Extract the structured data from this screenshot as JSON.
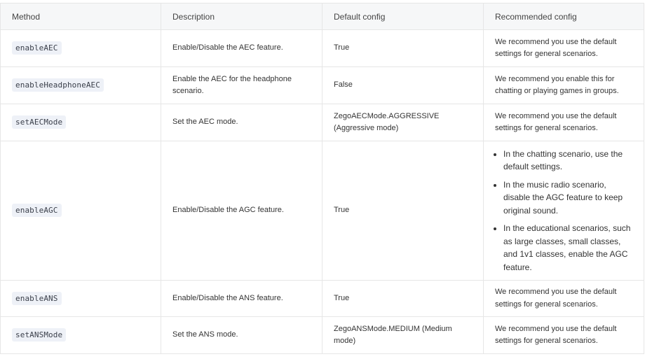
{
  "table": {
    "headers": [
      "Method",
      "Description",
      "Default config",
      "Recommended config"
    ],
    "rows": [
      {
        "method": "enableAEC",
        "description": "Enable/Disable the AEC feature.",
        "default": "True",
        "recommended": "We recommend you use the default settings for general scenarios."
      },
      {
        "method": "enableHeadphoneAEC",
        "description": "Enable the AEC for the headphone scenario.",
        "default": "False",
        "recommended": "We recommend you enable this for chatting or playing games in groups."
      },
      {
        "method": "setAECMode",
        "description": "Set the AEC mode.",
        "default": "ZegoAECMode.AGGRESSIVE (Aggressive mode)",
        "recommended": "We recommend you use the default settings for general scenarios."
      },
      {
        "method": "enableAGC",
        "description": "Enable/Disable the AGC feature.",
        "default": "True",
        "recommended_list": [
          "In the chatting scenario, use the default settings.",
          "In the music radio scenario, disable the AGC feature to keep original sound.",
          "In the educational scenarios, such as large classes, small classes, and 1v1 classes, enable the AGC feature."
        ]
      },
      {
        "method": "enableANS",
        "description": "Enable/Disable the ANS feature.",
        "default": "True",
        "recommended": "We recommend you use the default settings for general scenarios."
      },
      {
        "method": "setANSMode",
        "description": "Set the ANS mode.",
        "default": "ZegoANSMode.MEDIUM (Medium mode)",
        "recommended": "We recommend you use the default settings for general scenarios."
      }
    ]
  }
}
